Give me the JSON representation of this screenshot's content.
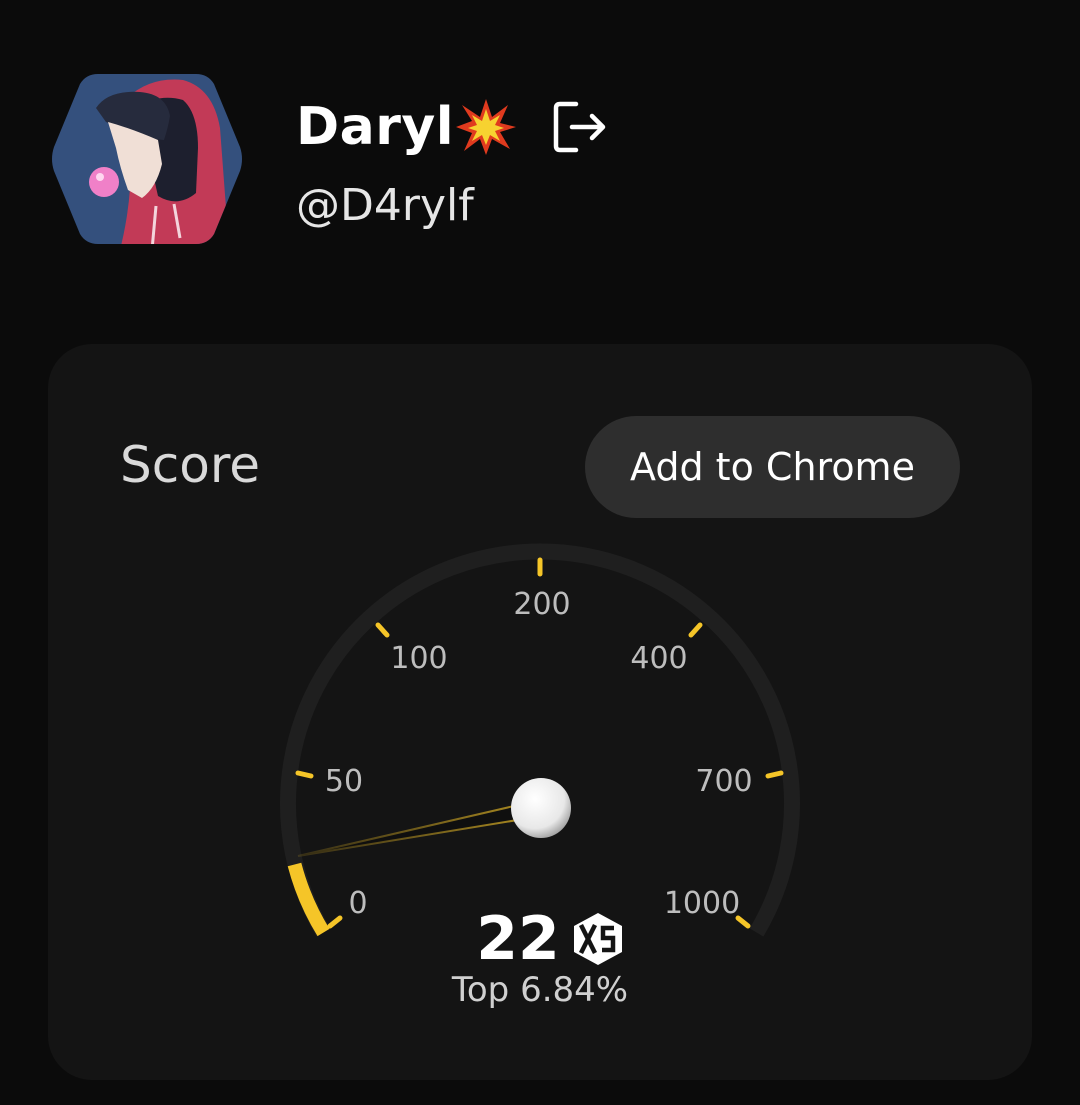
{
  "profile": {
    "display_name": "Daryl",
    "handle": "@D4rylf",
    "name_emoji_icon": "collision-burst-icon",
    "logout_icon": "logout-icon",
    "avatar_icon": "hexagon-avatar"
  },
  "score_card": {
    "label": "Score",
    "add_button_label": "Add to Chrome",
    "gauge": {
      "tick_labels": [
        "0",
        "50",
        "100",
        "200",
        "400",
        "700",
        "1000"
      ],
      "needle_value": 22,
      "accent_color": "#f5c528"
    },
    "score_value": "22",
    "badge_icon": "xs-badge-icon",
    "top_percent": "Top 6.84%"
  }
}
